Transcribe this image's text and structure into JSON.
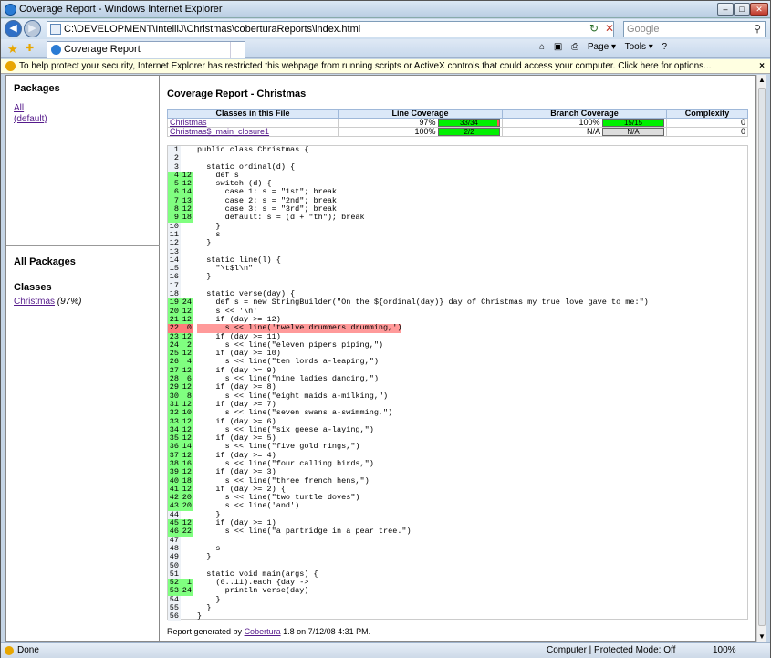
{
  "window": {
    "title": "Coverage Report - Windows Internet Explorer"
  },
  "address": {
    "url": "C:\\DEVELOPMENT\\IntelliJ\\Christmas\\coberturaReports\\index.html",
    "search_placeholder": "Google"
  },
  "tab": {
    "label": "Coverage Report"
  },
  "commands": [
    "Page ▾",
    "Tools ▾"
  ],
  "infobar": {
    "text": "To help protect your security, Internet Explorer has restricted this webpage from running scripts or ActiveX controls that could access your computer. Click here for options..."
  },
  "left": {
    "packages_heading": "Packages",
    "packages": [
      "All",
      "(default)"
    ],
    "all_packages_heading": "All Packages",
    "classes_heading": "Classes",
    "classes": [
      {
        "name": "Christmas",
        "pct": " (97%)"
      }
    ]
  },
  "report": {
    "title": "Coverage Report - Christmas",
    "headers": [
      "Classes in this File",
      "Line Coverage",
      "Branch Coverage",
      "Complexity"
    ],
    "rows": [
      {
        "name": "Christmas",
        "line_pct": "97%",
        "line_frac": "33/34",
        "line_ratio": 0.97,
        "branch_pct": "100%",
        "branch_frac": "15/15",
        "branch_ratio": 1.0,
        "complexity": "0"
      },
      {
        "name": "Christmas$_main_closure1",
        "line_pct": "100%",
        "line_frac": "2/2",
        "line_ratio": 1.0,
        "branch_pct": "N/A",
        "branch_frac": "N/A",
        "branch_ratio": null,
        "complexity": "0"
      }
    ]
  },
  "code": [
    {
      "n": "1",
      "h": "",
      "s": "public class Christmas {"
    },
    {
      "n": "2",
      "h": "",
      "s": ""
    },
    {
      "n": "3",
      "h": "",
      "s": "  static ordinal(d) {"
    },
    {
      "n": "4",
      "h": "12",
      "s": "    def s"
    },
    {
      "n": "5",
      "h": "12",
      "s": "    switch (d) {"
    },
    {
      "n": "6",
      "h": "14",
      "s": "      case 1: s = \"1st\"; break"
    },
    {
      "n": "7",
      "h": "13",
      "s": "      case 2: s = \"2nd\"; break"
    },
    {
      "n": "8",
      "h": "12",
      "s": "      case 3: s = \"3rd\"; break"
    },
    {
      "n": "9",
      "h": "18",
      "s": "      default: s = (d + \"th\"); break"
    },
    {
      "n": "10",
      "h": "",
      "s": "    }"
    },
    {
      "n": "11",
      "h": "",
      "s": "    s"
    },
    {
      "n": "12",
      "h": "",
      "s": "  }"
    },
    {
      "n": "13",
      "h": "",
      "s": ""
    },
    {
      "n": "14",
      "h": "",
      "s": "  static line(l) {"
    },
    {
      "n": "15",
      "h": "",
      "s": "    \"\\t$l\\n\""
    },
    {
      "n": "16",
      "h": "",
      "s": "  }"
    },
    {
      "n": "17",
      "h": "",
      "s": ""
    },
    {
      "n": "18",
      "h": "",
      "s": "  static verse(day) {"
    },
    {
      "n": "19",
      "h": "24",
      "s": "    def s = new StringBuilder(\"On the ${ordinal(day)} day of Christmas my true love gave to me:\")"
    },
    {
      "n": "20",
      "h": "12",
      "s": "    s << '\\n'"
    },
    {
      "n": "21",
      "h": "12",
      "s": "    if (day >= 12)"
    },
    {
      "n": "22",
      "h": "0",
      "s": "      s << line('twelve drummers drumming,')"
    },
    {
      "n": "23",
      "h": "12",
      "s": "    if (day >= 11)"
    },
    {
      "n": "24",
      "h": "2",
      "s": "      s << line(\"eleven pipers piping,\")"
    },
    {
      "n": "25",
      "h": "12",
      "s": "    if (day >= 10)"
    },
    {
      "n": "26",
      "h": "4",
      "s": "      s << line(\"ten lords a-leaping,\")"
    },
    {
      "n": "27",
      "h": "12",
      "s": "    if (day >= 9)"
    },
    {
      "n": "28",
      "h": "6",
      "s": "      s << line(\"nine ladies dancing,\")"
    },
    {
      "n": "29",
      "h": "12",
      "s": "    if (day >= 8)"
    },
    {
      "n": "30",
      "h": "8",
      "s": "      s << line(\"eight maids a-milking,\")"
    },
    {
      "n": "31",
      "h": "12",
      "s": "    if (day >= 7)"
    },
    {
      "n": "32",
      "h": "10",
      "s": "      s << line(\"seven swans a-swimming,\")"
    },
    {
      "n": "33",
      "h": "12",
      "s": "    if (day >= 6)"
    },
    {
      "n": "34",
      "h": "12",
      "s": "      s << line(\"six geese a-laying,\")"
    },
    {
      "n": "35",
      "h": "12",
      "s": "    if (day >= 5)"
    },
    {
      "n": "36",
      "h": "14",
      "s": "      s << line(\"five gold rings,\")"
    },
    {
      "n": "37",
      "h": "12",
      "s": "    if (day >= 4)"
    },
    {
      "n": "38",
      "h": "16",
      "s": "      s << line(\"four calling birds,\")"
    },
    {
      "n": "39",
      "h": "12",
      "s": "    if (day >= 3)"
    },
    {
      "n": "40",
      "h": "18",
      "s": "      s << line(\"three french hens,\")"
    },
    {
      "n": "41",
      "h": "12",
      "s": "    if (day >= 2) {"
    },
    {
      "n": "42",
      "h": "20",
      "s": "      s << line(\"two turtle doves\")"
    },
    {
      "n": "43",
      "h": "20",
      "s": "      s << line('and')"
    },
    {
      "n": "44",
      "h": "",
      "s": "    }"
    },
    {
      "n": "45",
      "h": "12",
      "s": "    if (day >= 1)"
    },
    {
      "n": "46",
      "h": "22",
      "s": "      s << line(\"a partridge in a pear tree.\")"
    },
    {
      "n": "47",
      "h": "",
      "s": ""
    },
    {
      "n": "48",
      "h": "",
      "s": "    s"
    },
    {
      "n": "49",
      "h": "",
      "s": "  }"
    },
    {
      "n": "50",
      "h": "",
      "s": ""
    },
    {
      "n": "51",
      "h": "",
      "s": "  static void main(args) {"
    },
    {
      "n": "52",
      "h": "1",
      "s": "    (0..11).each {day ->"
    },
    {
      "n": "53",
      "h": "24",
      "s": "      println verse(day)"
    },
    {
      "n": "54",
      "h": "",
      "s": "    }"
    },
    {
      "n": "55",
      "h": "",
      "s": "  }"
    },
    {
      "n": "56",
      "h": "",
      "s": "}"
    }
  ],
  "footer": {
    "prefix": "Report generated by ",
    "link": "Cobertura",
    "suffix": " 1.8 on 7/12/08 4:31 PM."
  },
  "status": {
    "text": "Done",
    "zone": "Computer | Protected Mode: Off",
    "zoom": "100%"
  },
  "colors": {
    "covered": "#80ff80",
    "uncovered": "#ff7a7a",
    "bar_fill": "#00f000",
    "bar_empty": "#ff5555"
  }
}
